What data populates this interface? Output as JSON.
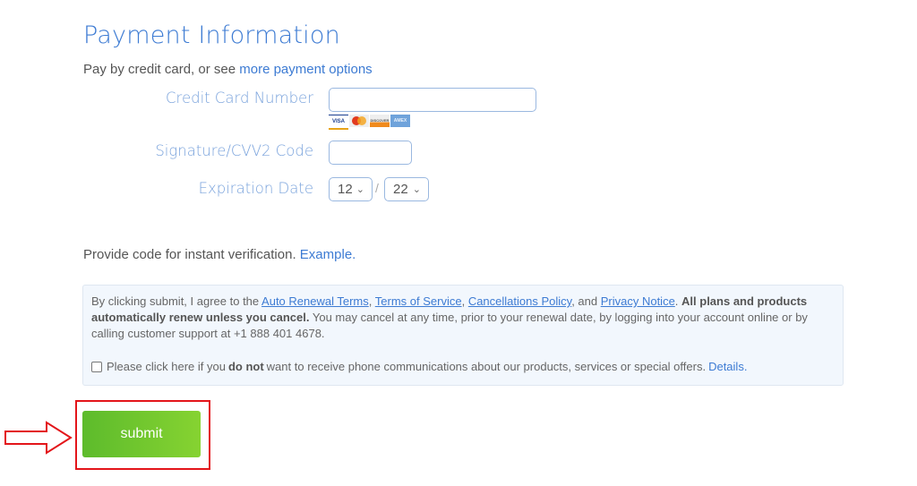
{
  "title": "Payment Information",
  "subtitle": {
    "text": "Pay by credit card, or see ",
    "link": "more payment options"
  },
  "form": {
    "cc_label": "Credit Card Number",
    "cc_value": "",
    "cards": [
      "VISA",
      "MC",
      "DISCOVER",
      "AMEX"
    ],
    "cvv_label": "Signature/CVV2 Code",
    "cvv_value": "",
    "exp_label": "Expiration Date",
    "exp_month": "12",
    "exp_sep": "/",
    "exp_year": "22"
  },
  "verify": {
    "text": "Provide code for instant verification. ",
    "link": "Example."
  },
  "terms": {
    "t1": "By clicking submit, I agree to the ",
    "l1": "Auto Renewal Terms",
    "s1": ", ",
    "l2": "Terms of Service",
    "s2": ", ",
    "l3": "Cancellations Policy",
    "s3": ", and ",
    "l4": "Privacy Notice",
    "s4": ". ",
    "bold": "All plans and products automatically renew unless you cancel.",
    "t2": " You may cancel at any time, prior to your renewal date, by logging into your account online or by calling customer support at +1 888 401 4678.",
    "chk1": "Please click here if you ",
    "chk_bold": "do not",
    "chk2": " want to receive phone communications about our products, services or special offers. ",
    "details": "Details.",
    "checked": false
  },
  "submit_label": "submit",
  "colors": {
    "accent": "#3d7bd3",
    "submit": "#6cc42e",
    "highlight": "#e3151a"
  }
}
